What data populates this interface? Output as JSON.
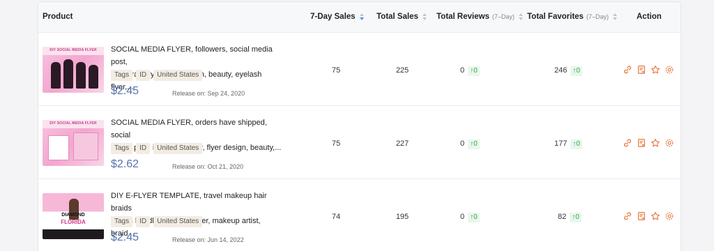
{
  "header": {
    "product": "Product",
    "seven_day_sales": "7-Day Sales",
    "total_sales": "Total Sales",
    "total_reviews": "Total Reviews",
    "total_reviews_sub": "(7–Day)",
    "total_favorites": "Total Favorites",
    "total_favorites_sub": "(7–Day)",
    "action": "Action"
  },
  "rows": [
    {
      "title_line1": "SOCIAL MEDIA FLYER, followers, social media post,",
      "title_line2": "instagram flyer, flyer design, beauty, eyelash flyer,...",
      "thumb_label": "DIY SOCIAL MEDIA FLYER",
      "tags": [
        "Tags",
        "ID",
        "United States"
      ],
      "price": "$2.45",
      "release": "Release on: Sep 24, 2020",
      "seven_day_sales": "75",
      "total_sales": "225",
      "total_reviews": "0",
      "reviews_delta": "↑0",
      "total_favorites": "246",
      "favorites_delta": "↑0"
    },
    {
      "title_line1": "SOCIAL MEDIA FLYER, orders have shipped, social",
      "title_line2": "media post, instagram flyer, flyer design, beauty,...",
      "thumb_label": "DIY SOCIAL MEDIA FLYER",
      "tags": [
        "Tags",
        "ID",
        "United States"
      ],
      "price": "$2.62",
      "release": "Release on: Oct 21, 2020",
      "seven_day_sales": "75",
      "total_sales": "227",
      "total_reviews": "0",
      "reviews_delta": "↑0",
      "total_favorites": "177",
      "favorites_delta": "↑0"
    },
    {
      "title_line1": "DIY E-FLYER TEMPLATE, travel makeup hair braids",
      "title_line2": "lashes bundles, travel e-flyer, makeup artist, braid...",
      "thumb_label": "DIAMOND",
      "thumb_label2": "FLORIDA",
      "tags": [
        "Tags",
        "ID",
        "United States"
      ],
      "price": "$2.45",
      "release": "Release on: Jun 14, 2022",
      "seven_day_sales": "74",
      "total_sales": "195",
      "total_reviews": "0",
      "reviews_delta": "↑0",
      "total_favorites": "82",
      "favorites_delta": "↑0"
    }
  ],
  "colors": {
    "accent_blue": "#4a8ff0",
    "price": "#5672b0",
    "action_orange": "#e8743b",
    "delta_green": "#2ea843"
  },
  "icons": [
    "link-icon",
    "report-icon",
    "star-icon",
    "settings-icon"
  ]
}
